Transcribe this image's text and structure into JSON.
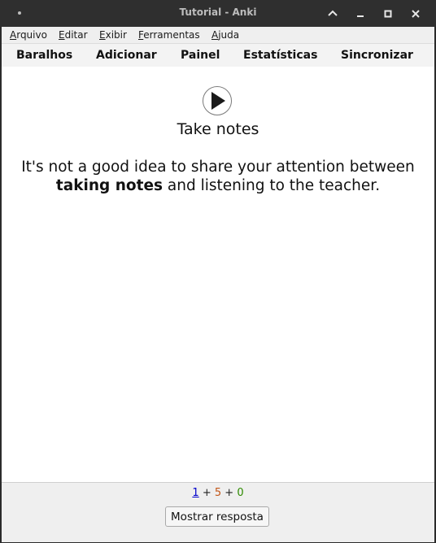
{
  "window": {
    "title": "Tutorial - Anki"
  },
  "menubar": {
    "items": [
      {
        "label_first": "A",
        "label_rest": "rquivo"
      },
      {
        "label_first": "E",
        "label_rest": "ditar"
      },
      {
        "label_first": "E",
        "label_rest": "xibir"
      },
      {
        "label_first": "F",
        "label_rest": "erramentas"
      },
      {
        "label_first": "A",
        "label_rest": "juda"
      }
    ]
  },
  "toolbar": {
    "items": [
      {
        "label": "Baralhos"
      },
      {
        "label": "Adicionar"
      },
      {
        "label": "Painel"
      },
      {
        "label": "Estatísticas"
      },
      {
        "label": "Sincronizar"
      }
    ]
  },
  "card": {
    "title": "Take notes",
    "text_before": "It's not a good idea to share your attention between ",
    "text_bold": "taking notes",
    "text_after": " and listening to the teacher."
  },
  "bottom": {
    "count_new": "1",
    "count_learning": "5",
    "count_review": "0",
    "plus": "+",
    "show_answer": "Mostrar resposta"
  },
  "colors": {
    "new": "#0000cc",
    "learning": "#c35617",
    "review": "#2e8b00"
  }
}
